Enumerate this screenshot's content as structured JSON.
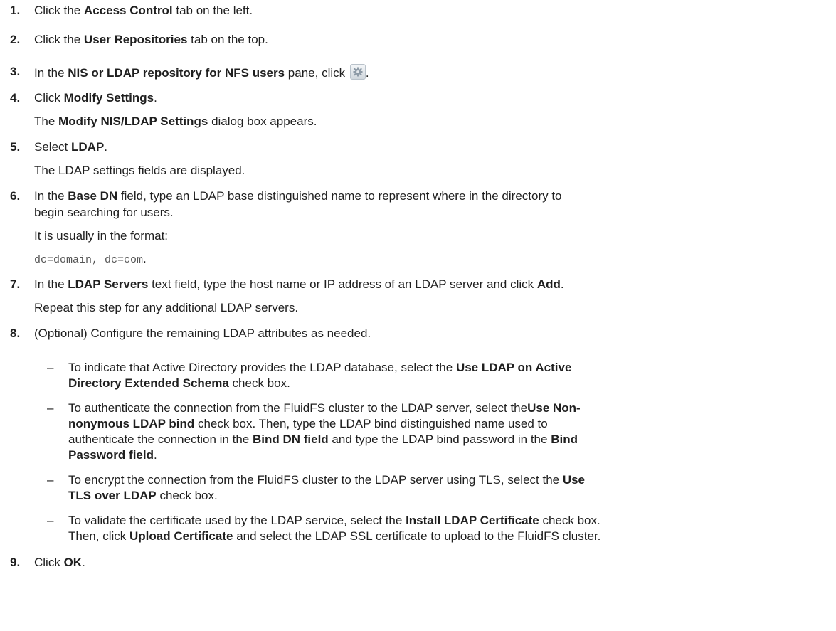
{
  "steps": [
    {
      "num": "1.",
      "pre": "Click the ",
      "bold": "Access Control",
      "post": " tab on the left."
    },
    {
      "num": "2.",
      "pre": "Click the ",
      "bold": "User Repositories",
      "post": " tab on the top."
    },
    {
      "num": "3.",
      "pre": "In the ",
      "bold": "NIS or LDAP repository for NFS users",
      "post": " pane, click ",
      "tail": ".",
      "icon": "settings-gear-icon"
    },
    {
      "num": "4.",
      "pre": "Click ",
      "bold": "Modify Settings",
      "post": ".",
      "sub_pre": "The ",
      "sub_bold": "Modify NIS/LDAP Settings",
      "sub_post": " dialog box appears."
    },
    {
      "num": "5.",
      "pre": "Select ",
      "bold": "LDAP",
      "post": ".",
      "sub": "The LDAP settings fields are displayed."
    },
    {
      "num": "6.",
      "pre": "In the ",
      "bold": "Base DN",
      "post": " field, type an LDAP base distinguished name to represent where in the directory to",
      "cont": "begin searching for users.",
      "sub": "It is usually in the format:",
      "code": "dc=domain, dc=com",
      "code_tail": "."
    },
    {
      "num": "7.",
      "pre": "In the ",
      "bold": "LDAP Servers",
      "post": " text field, type the host name or IP address of an LDAP server and click ",
      "bold2": "Add",
      "post2": ".",
      "sub": "Repeat this step for any additional LDAP servers."
    },
    {
      "num": "8.",
      "text": "(Optional) Configure the remaining LDAP attributes as needed."
    },
    {
      "num": "9.",
      "pre": "Click ",
      "bold": "OK",
      "post": "."
    }
  ],
  "bullets": [
    {
      "dash": "–",
      "t1": "To indicate that Active Directory provides the LDAP database, select the ",
      "b1": "Use LDAP on Active",
      "b1b": "Directory Extended Schema",
      "t2": " check box."
    },
    {
      "dash": "–",
      "t1": "To authenticate the connection from the FluidFS cluster to the LDAP server, select the",
      "b1": "Use Non-",
      "b1b": "nonymous LDAP bind",
      "t2": " check box. Then, type the LDAP bind distinguished name used to",
      "t3": "authenticate the connection in the ",
      "b2": "Bind DN field",
      "t4": " and type the LDAP bind password in the ",
      "b3": "Bind",
      "b3b": "Password field",
      "t5": "."
    },
    {
      "dash": "–",
      "t1": "To encrypt the connection from the FluidFS cluster to the LDAP server using TLS, select the ",
      "b1": "Use",
      "b1b": "TLS over LDAP",
      "t2": " check box."
    },
    {
      "dash": "–",
      "t1": "To validate the certificate used by the LDAP service, select the ",
      "b1": "Install LDAP Certificate",
      "t2": " check box.",
      "t3": "Then, click ",
      "b2": "Upload Certificate",
      "t4": " and select the LDAP SSL certificate to upload to the FluidFS cluster."
    }
  ]
}
